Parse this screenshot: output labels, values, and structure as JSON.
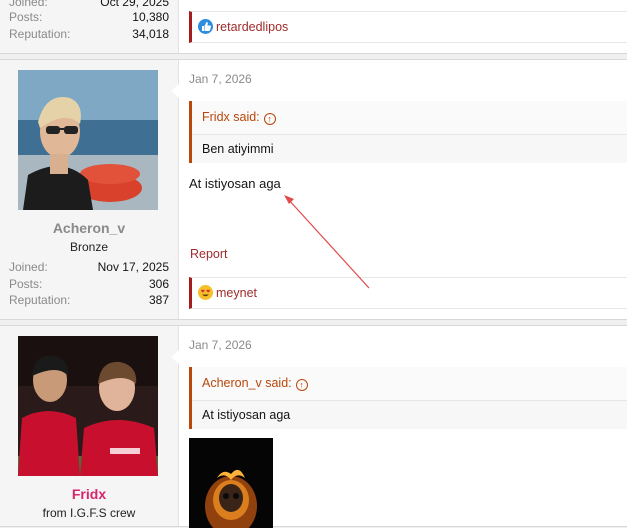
{
  "post_top": {
    "stats": [
      {
        "label": "Joined:",
        "value": "Oct 29, 2025"
      },
      {
        "label": "Posts:",
        "value": "10,380"
      },
      {
        "label": "Reputation:",
        "value": "34,018"
      }
    ],
    "reaction_user": "retardedlipos",
    "reaction_icon": "like-icon"
  },
  "post_acheron": {
    "date": "Jan 7, 2026",
    "username": "Acheron_v",
    "user_title": "Bronze",
    "stats": [
      {
        "label": "Joined:",
        "value": "Nov 17, 2025"
      },
      {
        "label": "Posts:",
        "value": "306"
      },
      {
        "label": "Reputation:",
        "value": "387"
      }
    ],
    "quote_author": "Fridx said:",
    "quote_text": "Ben atiyimmi",
    "message": "At istiyosan aga",
    "report_label": "Report",
    "reaction_user": "meynet",
    "reaction_icon": "heart-eyes-icon"
  },
  "post_fridx": {
    "date": "Jan 7, 2026",
    "username": "Fridx",
    "user_title": "from I.G.F.S crew",
    "quote_author": "Acheron_v said:",
    "quote_text": "At istiyosan aga"
  },
  "colors": {
    "accent": "#b9460a",
    "link": "#a02b2b",
    "fridx_name": "#d6246e",
    "acheron_name": "#8a8a8a"
  }
}
